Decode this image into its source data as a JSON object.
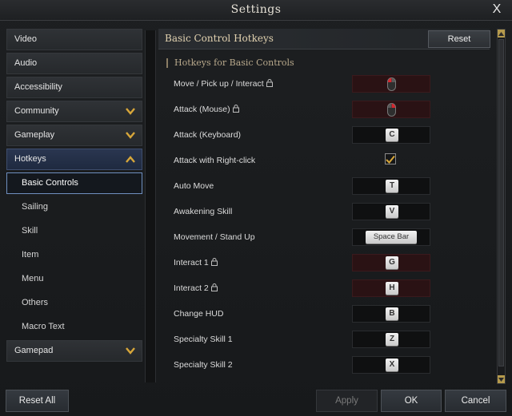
{
  "window": {
    "title": "Settings",
    "close_label": "X"
  },
  "sidebar": {
    "items": [
      {
        "label": "Video",
        "expandable": false
      },
      {
        "label": "Audio",
        "expandable": false
      },
      {
        "label": "Accessibility",
        "expandable": false
      },
      {
        "label": "Community",
        "expandable": true,
        "expanded": false
      },
      {
        "label": "Gameplay",
        "expandable": true,
        "expanded": false
      },
      {
        "label": "Hotkeys",
        "expandable": true,
        "expanded": true
      },
      {
        "label": "Gamepad",
        "expandable": true,
        "expanded": false
      }
    ],
    "hotkeys_subitems": [
      {
        "label": "Basic Controls",
        "active": true
      },
      {
        "label": "Sailing",
        "active": false
      },
      {
        "label": "Skill",
        "active": false
      },
      {
        "label": "Item",
        "active": false
      },
      {
        "label": "Menu",
        "active": false
      },
      {
        "label": "Others",
        "active": false
      },
      {
        "label": "Macro Text",
        "active": false
      }
    ]
  },
  "main": {
    "title": "Basic Control Hotkeys",
    "reset_label": "Reset",
    "group_title": "Hotkeys for Basic Controls",
    "rows": [
      {
        "label": "Move / Pick up / Interact",
        "locked": true,
        "binding": "left-mouse-icon",
        "type": "mouse-left"
      },
      {
        "label": "Attack (Mouse)",
        "locked": true,
        "binding": "right-mouse-icon",
        "type": "mouse-right"
      },
      {
        "label": "Attack (Keyboard)",
        "locked": false,
        "binding": "C",
        "type": "key"
      },
      {
        "label": "Attack with Right-click",
        "locked": false,
        "binding": "checked",
        "type": "checkbox"
      },
      {
        "label": "Auto Move",
        "locked": false,
        "binding": "T",
        "type": "key"
      },
      {
        "label": "Awakening Skill",
        "locked": false,
        "binding": "V",
        "type": "key"
      },
      {
        "label": "Movement / Stand Up",
        "locked": false,
        "binding": "Space Bar",
        "type": "wide"
      },
      {
        "label": "Interact 1",
        "locked": true,
        "binding": "G",
        "type": "key"
      },
      {
        "label": "Interact 2",
        "locked": true,
        "binding": "H",
        "type": "key"
      },
      {
        "label": "Change HUD",
        "locked": false,
        "binding": "B",
        "type": "key"
      },
      {
        "label": "Specialty Skill 1",
        "locked": false,
        "binding": "Z",
        "type": "key"
      },
      {
        "label": "Specialty Skill 2",
        "locked": false,
        "binding": "X",
        "type": "key"
      }
    ]
  },
  "footer": {
    "reset_all_label": "Reset All",
    "apply_label": "Apply",
    "ok_label": "OK",
    "cancel_label": "Cancel"
  },
  "colors": {
    "accent_gold": "#d8a73a",
    "title_gold": "#e2d2b0",
    "active_border": "#6f8fc0",
    "locked_slot": "#2a1214"
  }
}
